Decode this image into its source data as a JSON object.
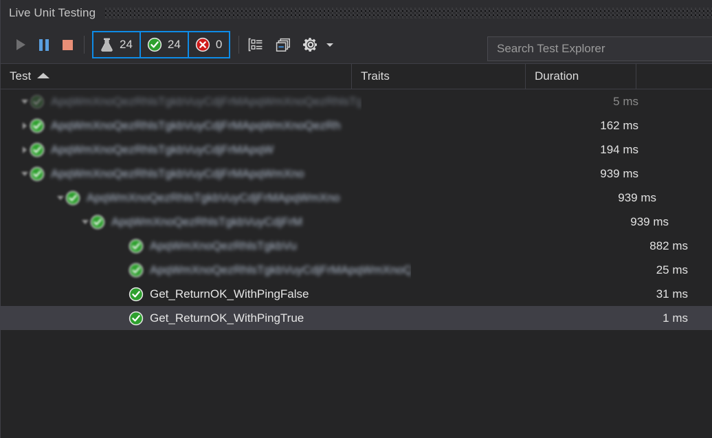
{
  "window": {
    "title": "Live Unit Testing"
  },
  "toolbar": {
    "run_label": "Run",
    "pause_label": "Pause",
    "stop_label": "Stop",
    "counters": [
      {
        "name": "total",
        "icon": "flask-icon",
        "value": "24"
      },
      {
        "name": "passed",
        "icon": "pass-circle-icon",
        "value": "24"
      },
      {
        "name": "failed",
        "icon": "fail-circle-icon",
        "value": "0"
      }
    ],
    "group_by_label": "Group By",
    "collapse_all_label": "Collapse All",
    "settings_label": "Settings",
    "settings_caret_label": "Settings options"
  },
  "search": {
    "placeholder": "Search Test Explorer",
    "value": ""
  },
  "columns": [
    {
      "key": "test",
      "label": "Test",
      "sort": "ascending"
    },
    {
      "key": "traits",
      "label": "Traits",
      "sort": ""
    },
    {
      "key": "duration",
      "label": "Duration",
      "sort": ""
    },
    {
      "key": "extra",
      "label": "",
      "sort": ""
    }
  ],
  "rows": [
    {
      "name": "",
      "duration": "5 ms",
      "indent": 0,
      "status": "pending",
      "redacted": true,
      "expandable": true,
      "expanded": true,
      "selected": false,
      "dim": true
    },
    {
      "name": "",
      "duration": "162 ms",
      "indent": 0,
      "status": "passed",
      "redacted": true,
      "expandable": true,
      "expanded": false,
      "selected": false,
      "dim": false
    },
    {
      "name": "",
      "duration": "194 ms",
      "indent": 0,
      "status": "passed",
      "redacted": true,
      "expandable": true,
      "expanded": false,
      "selected": false,
      "dim": false
    },
    {
      "name": "",
      "duration": "939 ms",
      "indent": 0,
      "status": "passed",
      "redacted": true,
      "expandable": true,
      "expanded": true,
      "selected": false,
      "dim": false
    },
    {
      "name": "",
      "duration": "939 ms",
      "indent": 1,
      "status": "passed",
      "redacted": true,
      "expandable": true,
      "expanded": true,
      "selected": false,
      "dim": false
    },
    {
      "name": "",
      "duration": "939 ms",
      "indent": 2,
      "status": "passed",
      "redacted": true,
      "expandable": true,
      "expanded": true,
      "selected": false,
      "dim": false
    },
    {
      "name": "",
      "duration": "882 ms",
      "indent": 3,
      "status": "passed",
      "redacted": true,
      "expandable": false,
      "expanded": false,
      "selected": false,
      "dim": false
    },
    {
      "name": "",
      "duration": "25 ms",
      "indent": 3,
      "status": "passed",
      "redacted": true,
      "expandable": false,
      "expanded": false,
      "selected": false,
      "dim": false
    },
    {
      "name": "Get_ReturnOK_WithPingFalse",
      "duration": "31 ms",
      "indent": 3,
      "status": "passed",
      "redacted": false,
      "expandable": false,
      "expanded": false,
      "selected": false,
      "dim": false
    },
    {
      "name": "Get_ReturnOK_WithPingTrue",
      "duration": "1 ms",
      "indent": 3,
      "status": "passed",
      "redacted": false,
      "expandable": false,
      "expanded": false,
      "selected": true,
      "dim": false
    }
  ],
  "colors": {
    "accent_blue": "#0e8ce8",
    "pass_green": "#3aa93a",
    "fail_red": "#d62121",
    "pause_blue": "#5a9fe0",
    "stop_salmon": "#e98f77",
    "panel_bg": "#252526",
    "chrome_bg": "#2d2d30",
    "selection_bg": "#3f3f46",
    "text": "#e6e6e6"
  }
}
